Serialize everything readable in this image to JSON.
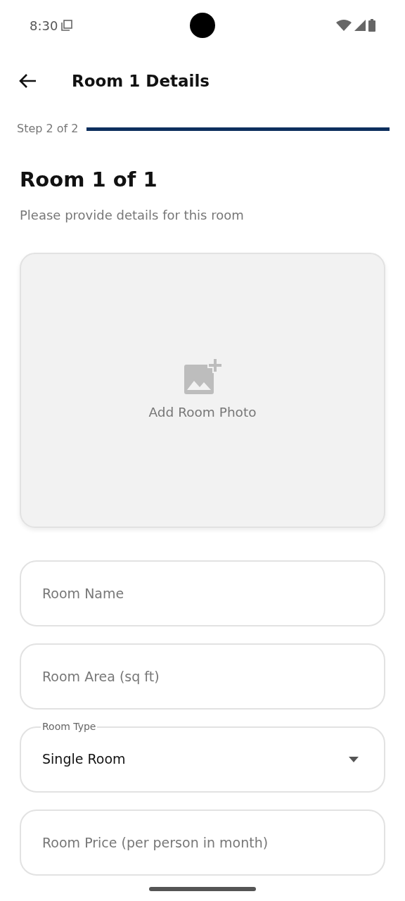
{
  "status_bar": {
    "time": "8:30"
  },
  "header": {
    "title": "Room 1 Details"
  },
  "progress": {
    "label": "Step 2 of 2",
    "level": 1
  },
  "heading": "Room 1 of 1",
  "subtitle": "Please provide details for this room",
  "photo": {
    "label": "Add Room Photo"
  },
  "fields": [
    {
      "kind": "text",
      "placeholder": "Room Name"
    },
    {
      "kind": "text",
      "placeholder": "Room Area (sq ft)"
    },
    {
      "kind": "select",
      "label": "Room Type",
      "value": "Single Room"
    },
    {
      "kind": "text",
      "placeholder": "Room Price (per person in month)"
    }
  ]
}
